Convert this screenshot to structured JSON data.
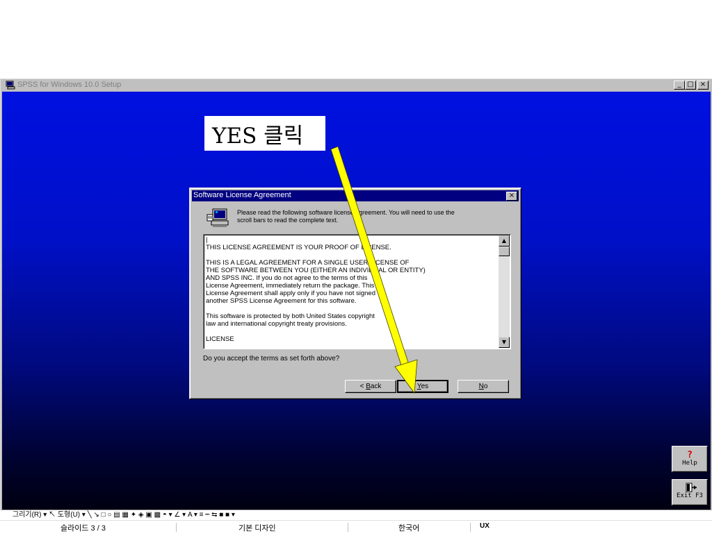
{
  "setup_window": {
    "title": "SPSS for Windows 10.0 Setup",
    "min_btn": "_",
    "max_btn": "□",
    "close_btn": "×"
  },
  "callout": {
    "text": "YES 클릭"
  },
  "dialog": {
    "title": "Software License Agreement",
    "close_btn": "×",
    "intro": "Please read the following software license agreement.  You will need to use the scroll bars to read the complete text.",
    "license_text": "|\nTHIS LICENSE AGREEMENT IS YOUR PROOF OF LICENSE.\n\nTHIS IS A LEGAL AGREEMENT FOR A SINGLE USER LICENSE OF\nTHE SOFTWARE BETWEEN YOU (EITHER AN INDIVIDUAL OR ENTITY)\nAND SPSS INC. If you do not agree to the terms of this\nLicense Agreement, immediately return the package. This\nLicense Agreement shall apply only if you have not signed\nanother SPSS License Agreement for this software.\n\nThis software is protected by both United States copyright\nlaw and international copyright treaty provisions.\n\nLICENSE",
    "question": "Do you accept the terms as set forth above?",
    "back_prefix": "< ",
    "back_key": "B",
    "back_rest": "ack",
    "yes_key": "Y",
    "yes_rest": "es",
    "no_key": "N",
    "no_rest": "o"
  },
  "side_buttons": {
    "help_symbol": "?",
    "help_label": "Help",
    "exit_label": "Exit F3"
  },
  "draw_toolbar": {
    "text": "그리기(R) ▾  ↖  도형(U) ▾  ╲  ↘  □  ○  ▤  ▦  ✦  ◈  ▣  ▩   ◓ ▾  ∠ ▾  A ▾  ≡  ┅  ⇆  ■  ■ ▾"
  },
  "status_bar": {
    "slide": "슬라이드 3 / 3",
    "design": "기본 디자인",
    "language": "한국어",
    "indicator": "UX"
  },
  "colors": {
    "title_active": "#000080",
    "face": "#c0c0c0",
    "arrow": "#ffff00"
  }
}
